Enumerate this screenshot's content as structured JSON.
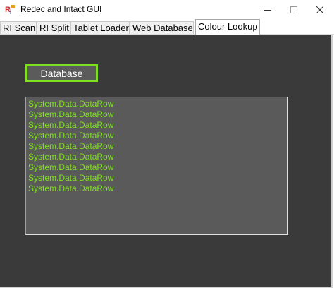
{
  "window": {
    "title": "Redec and Intact GUI"
  },
  "tabs": [
    {
      "label": "RI Scan",
      "selected": false
    },
    {
      "label": "RI Split",
      "selected": false
    },
    {
      "label": "Tablet Loader",
      "selected": false
    },
    {
      "label": "Web Database",
      "selected": false
    },
    {
      "label": "Colour Lookup",
      "selected": true
    }
  ],
  "panel": {
    "database_button_label": "Database",
    "list_items": [
      "System.Data.DataRow",
      "System.Data.DataRow",
      "System.Data.DataRow",
      "System.Data.DataRow",
      "System.Data.DataRow",
      "System.Data.DataRow",
      "System.Data.DataRow",
      "System.Data.DataRow",
      "System.Data.DataRow"
    ]
  },
  "colors": {
    "panel_background": "#3a3a3a",
    "accent_green": "#7fe020",
    "list_background": "#5a5a5a"
  },
  "icons": {
    "app": "app-icon",
    "minimize": "minimize-icon",
    "maximize": "maximize-icon",
    "close": "close-icon"
  }
}
